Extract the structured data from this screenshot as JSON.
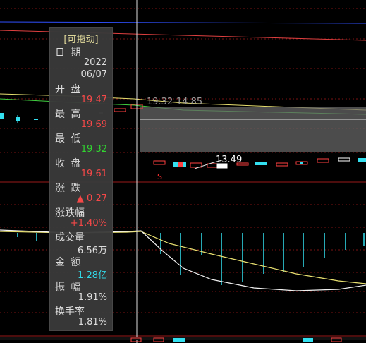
{
  "panel": {
    "drag_label": "[可拖动]",
    "rows": [
      {
        "label": "日 期",
        "value": "2022",
        "value2": "06/07",
        "color": "white"
      },
      {
        "label": "开 盘",
        "value": "19.47",
        "color": "red"
      },
      {
        "label": "最 高",
        "value": "19.69",
        "color": "red"
      },
      {
        "label": "最 低",
        "value": "19.32",
        "color": "green"
      },
      {
        "label": "收 盘",
        "value": "19.61",
        "color": "red"
      },
      {
        "label": "涨 跌",
        "value": "▲ 0.27",
        "color": "red"
      },
      {
        "label": "涨跌幅",
        "value": "+1.40%",
        "color": "red"
      },
      {
        "label": "成交量",
        "value": "6.56万",
        "color": "white"
      },
      {
        "label": "金 额",
        "value": "1.28亿",
        "color": "cyan"
      },
      {
        "label": "振 幅",
        "value": "1.91%",
        "color": "white"
      },
      {
        "label": "换手率",
        "value": "1.81%",
        "color": "white"
      }
    ]
  },
  "chart": {
    "range_label": "19.32-14.85",
    "low_label": "13.49",
    "marker_label": "S",
    "colors": {
      "up": "#ff4040",
      "down": "#33e0f0",
      "grid": "#8a1414",
      "bg": "#000000"
    }
  }
}
